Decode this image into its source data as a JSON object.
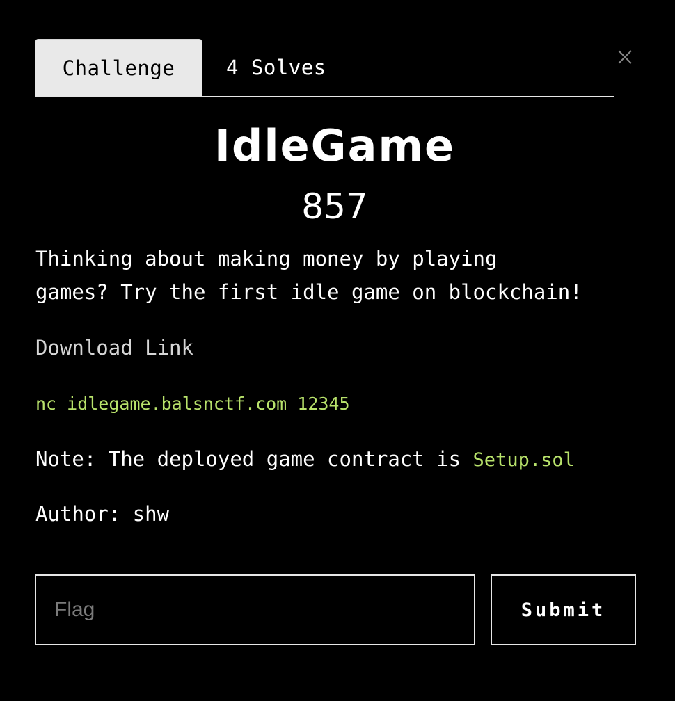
{
  "modal": {
    "close_icon": "close-icon",
    "close_color": "#8a8a8a"
  },
  "tabs": {
    "challenge_label": "Challenge",
    "solves_label": "4 Solves"
  },
  "challenge": {
    "name": "IdleGame",
    "value": "857",
    "description_lines": [
      "Thinking about making money by playing",
      "games? Try the first idle game on blockchain!"
    ],
    "download_link_label": "Download Link",
    "connection": "nc idlegame.balsnctf.com 12345",
    "note_prefix": "Note: The deployed game contract is ",
    "setup_link_label": "Setup.sol",
    "author_line": "Author: shw"
  },
  "form": {
    "flag_placeholder": "Flag",
    "flag_value": "",
    "submit_label": "Submit"
  },
  "colors": {
    "background": "#000000",
    "text": "#ffffff",
    "accent_green": "#b8e26b",
    "active_tab_background": "#e9e9e9",
    "border": "#e6e6e6"
  }
}
